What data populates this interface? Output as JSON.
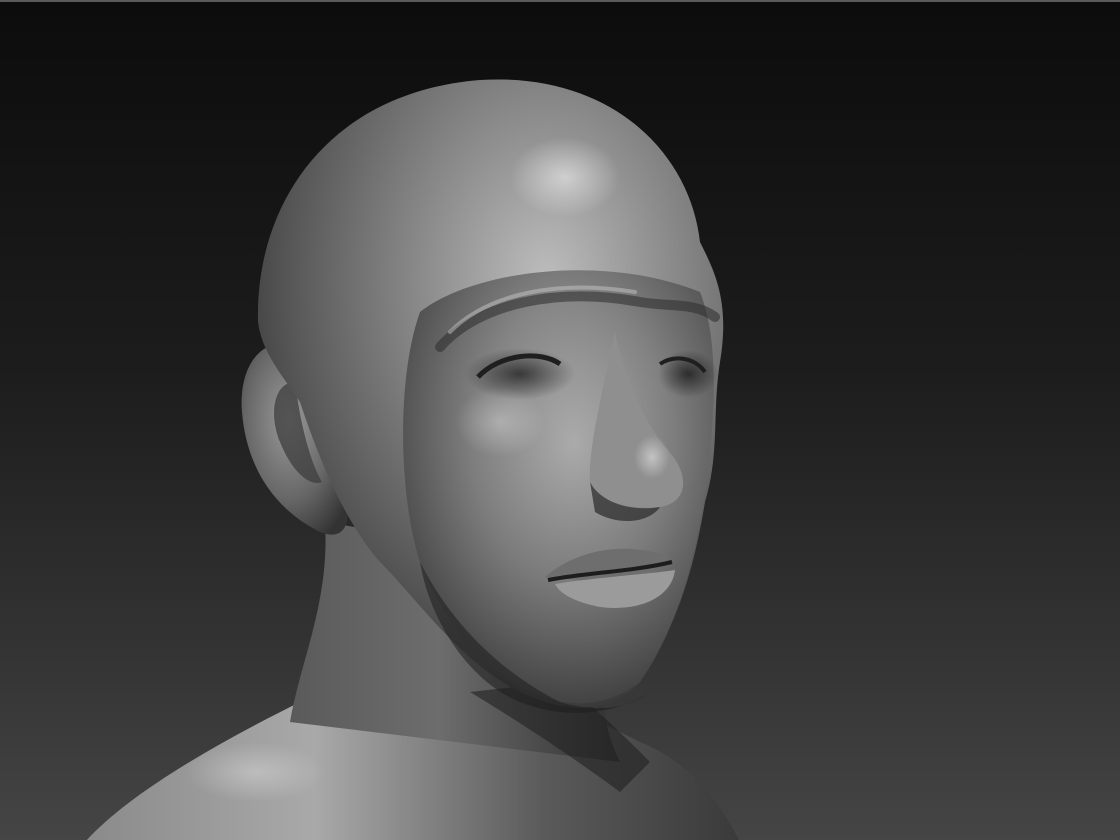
{
  "app": {
    "view": "3d-sculpt-viewport",
    "subject": "head-and-shoulders-bust",
    "material": "matcap-gray"
  },
  "colors": {
    "background_top": "#0c0c0c",
    "background_bottom": "#454545",
    "clay_light": "#c8c8c8",
    "clay_mid": "#7a7a7a",
    "clay_dark": "#2a2a2a",
    "frame_edge": "#5a5a5a"
  },
  "icons": {
    "model": "sculpted-bust-model"
  }
}
